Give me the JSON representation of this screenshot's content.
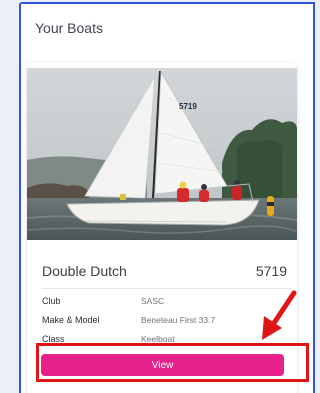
{
  "panel": {
    "title": "Your Boats"
  },
  "boat": {
    "name": "Double Dutch",
    "sail_number": "5719",
    "specs": [
      {
        "label": "Club",
        "value": "SASC"
      },
      {
        "label": "Make & Model",
        "value": "Beneteau First 33.7"
      },
      {
        "label": "Class",
        "value": "Keelboat"
      }
    ],
    "view_label": "View"
  },
  "photo": {
    "sail_text": "5719"
  },
  "colors": {
    "accent": "#e8208a",
    "panel_border": "#2f56d8",
    "annotation": "#e01515"
  }
}
